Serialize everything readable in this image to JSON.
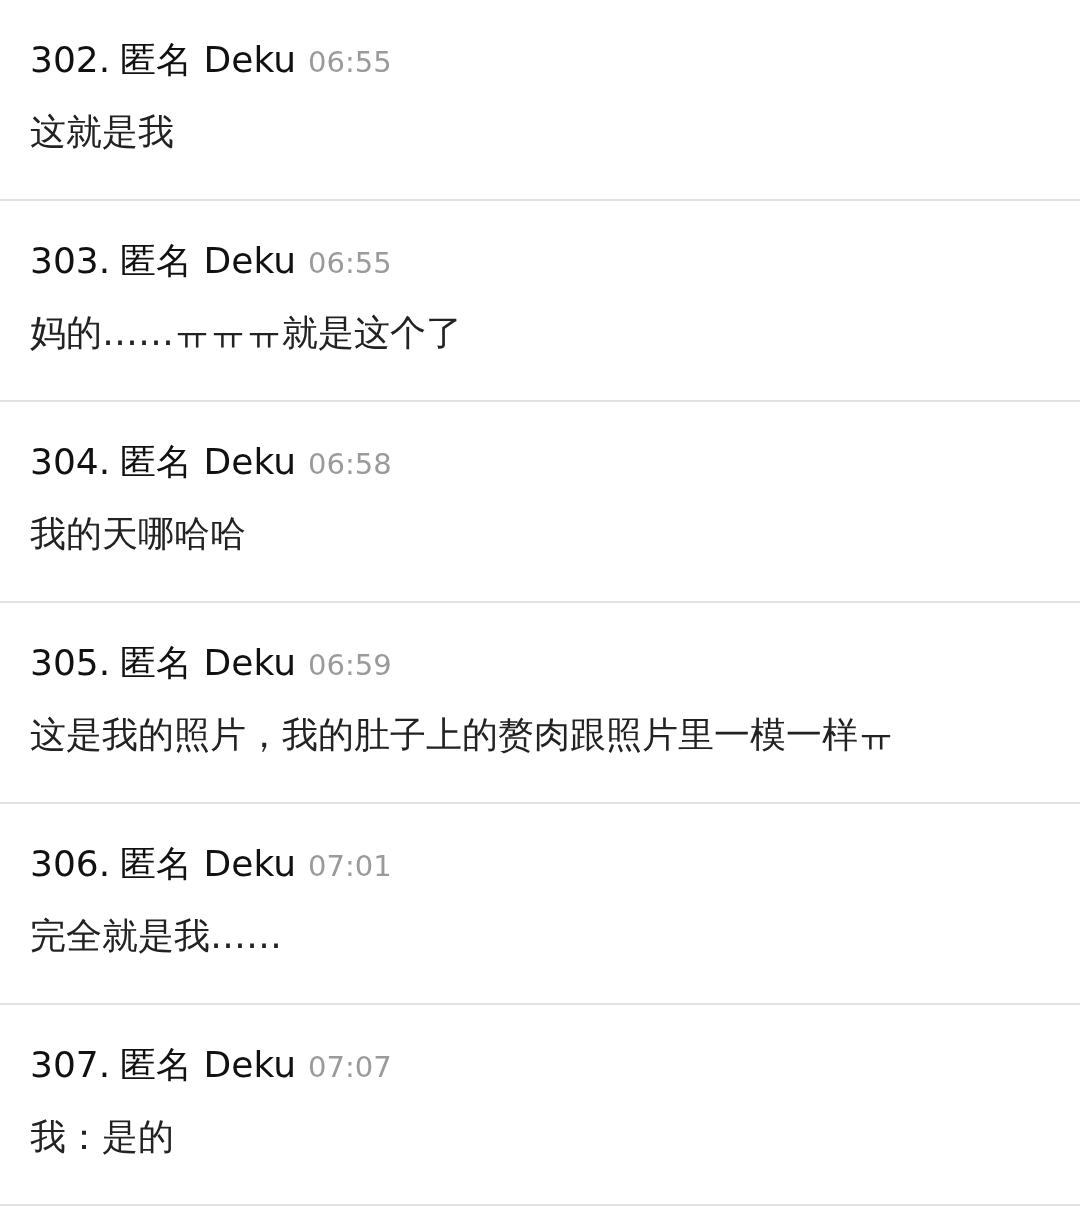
{
  "comments": [
    {
      "number": "302.",
      "author": "匿名 Deku",
      "time": "06:55",
      "text": "这就是我"
    },
    {
      "number": "303.",
      "author": "匿名 Deku",
      "time": "06:55",
      "text": "妈的……ㅠㅠㅠ就是这个了"
    },
    {
      "number": "304.",
      "author": "匿名 Deku",
      "time": "06:58",
      "text": "我的天哪哈哈"
    },
    {
      "number": "305.",
      "author": "匿名 Deku",
      "time": "06:59",
      "text": "这是我的照片，我的肚子上的赘肉跟照片里一模一样ㅠ"
    },
    {
      "number": "306.",
      "author": "匿名 Deku",
      "time": "07:01",
      "text": "完全就是我……"
    },
    {
      "number": "307.",
      "author": "匿名 Deku",
      "time": "07:07",
      "text": "我：是的"
    }
  ]
}
